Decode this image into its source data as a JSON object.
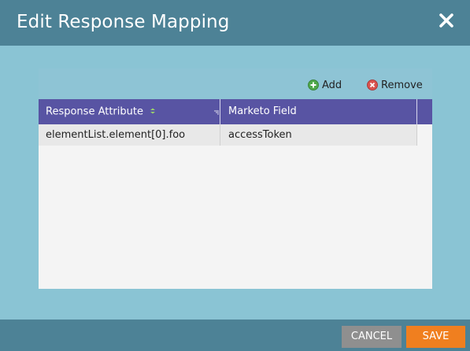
{
  "dialog": {
    "title": "Edit Response Mapping",
    "close_icon": "close-icon"
  },
  "toolbar": {
    "add_label": "Add",
    "add_icon": "plus-circle-icon",
    "remove_label": "Remove",
    "remove_icon": "x-circle-icon"
  },
  "grid": {
    "columns": [
      "Response Attribute",
      "Marketo Field"
    ],
    "rows": [
      [
        "elementList.element[0].foo",
        "accessToken"
      ]
    ]
  },
  "footer": {
    "cancel_label": "CANCEL",
    "save_label": "SAVE"
  },
  "colors": {
    "header_bg": "#4d8296",
    "body_bg": "#8ac4d4",
    "grid_header": "#5854a3",
    "save_button": "#f07f1f",
    "cancel_button": "#8f8f8f"
  }
}
